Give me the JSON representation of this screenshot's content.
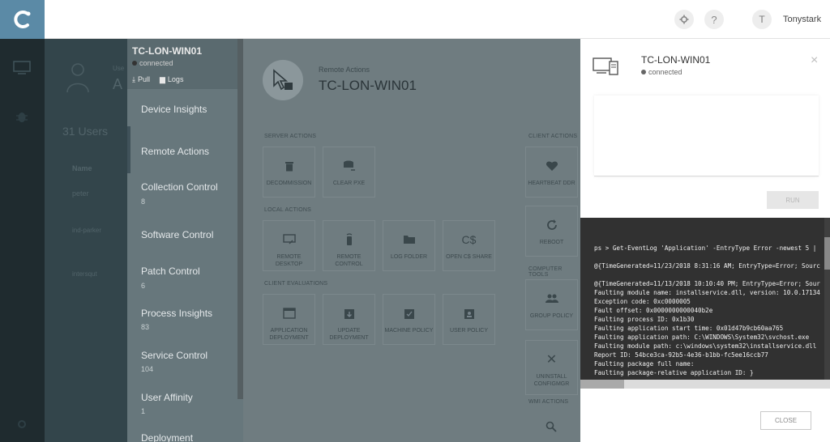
{
  "topbar": {
    "settings_icon": "gear-icon",
    "help_label": "?",
    "avatar_initial": "T",
    "username": "Tonystark"
  },
  "rail": {
    "items": [
      {
        "icon": "monitor-icon"
      },
      {
        "icon": "bug-icon"
      },
      {
        "icon": "settings-icon"
      }
    ]
  },
  "background_page": {
    "partial_header": "Use",
    "partial_title": "A",
    "users_count": "31 Users",
    "column_name": "Name",
    "rows": [
      "peter",
      "ind-parker",
      "intersqut"
    ]
  },
  "device_menu": {
    "title": "TC-LON-WIN01",
    "status": "connected",
    "pull_label": "Pull",
    "logs_label": "Logs",
    "items": [
      {
        "label": "Device Insights",
        "count": ""
      },
      {
        "label": "Remote Actions",
        "count": ""
      },
      {
        "label": "Collection Control",
        "count": "8"
      },
      {
        "label": "Software Control",
        "count": ""
      },
      {
        "label": "Patch Control",
        "count": "6"
      },
      {
        "label": "Process Insights",
        "count": "83"
      },
      {
        "label": "Service Control",
        "count": "104"
      },
      {
        "label": "User Affinity",
        "count": "1"
      },
      {
        "label": "Deployment",
        "count": ""
      }
    ]
  },
  "remote_actions": {
    "subtitle": "Remote Actions",
    "title": "TC-LON-WIN01",
    "sections": {
      "server": "SERVER ACTIONS",
      "local": "LOCAL ACTIONS",
      "client_eval": "CLIENT EVALUATIONS",
      "client": "CLIENT ACTIONS",
      "computer_tools": "COMPUTER TOOLS",
      "wmi": "WMI ACTIONS"
    },
    "tiles": {
      "decommission": "DECOMMISSION",
      "clear_pxe": "CLEAR PXE",
      "remote_desktop": "REMOTE DESKTOP",
      "remote_control": "REMOTE CONTROL",
      "log_folder": "LOG FOLDER",
      "open_cs_share": "OPEN C$ SHARE",
      "app_deployment": "APPLICATION DEPLOYMENT",
      "update_deployment": "UPDATE DEPLOYMENT",
      "machine_policy": "MACHINE POLICY",
      "user_policy": "USER POLICY",
      "heartbeat_ddr": "HEARTBEAT DDR",
      "reboot": "REBOOT",
      "group_policy": "GROUP POLICY",
      "uninstall_configmgr": "UNINSTALL CONFIGMGR"
    },
    "cs_glyph": "C$"
  },
  "modal": {
    "title": "TC-LON-WIN01",
    "status": "connected",
    "close_icon": "×",
    "run_label": "RUN",
    "close_label": "CLOSE",
    "terminal_lines": [
      "ps > Get-EventLog 'Application' -EntryType Error -newest 5 |",
      "",
      "@{TimeGenerated=11/23/2018 8:31:16 AM; EntryType=Error; Sourc",
      "",
      "@{TimeGenerated=11/13/2018 10:10:40 PM; EntryType=Error; Sour",
      "Faulting module name: installservice.dll, version: 10.0.17134",
      "Exception code: 0xc0000005",
      "Fault offset: 0x0000000000040b2e",
      "Faulting process ID: 0x1b30",
      "Faulting application start time: 0x01d47b9cb60aa765",
      "Faulting application path: C:\\WINDOWS\\System32\\svchost.exe",
      "Faulting module path: c:\\windows\\system32\\installservice.dll",
      "Report ID: 54bce3ca-92b5-4e36-b1bb-fc5ee16ccb77",
      "Faulting package full name:",
      "Faulting package-relative application ID: }"
    ]
  }
}
